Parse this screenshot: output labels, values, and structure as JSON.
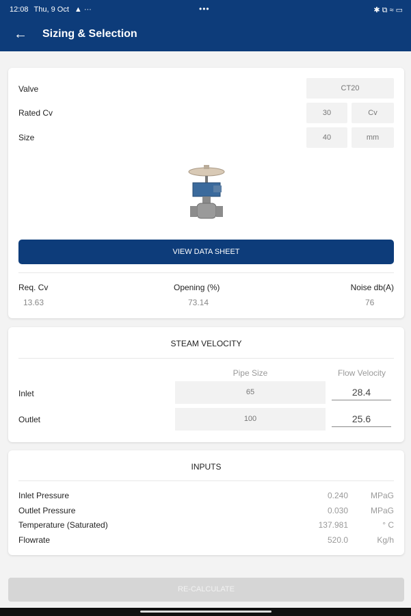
{
  "status": {
    "time": "12:08",
    "date": "Thu, 9 Oct",
    "extra": "▲ ···",
    "center": "•••",
    "right_icons": "✱ ⧉ ≈ ▭"
  },
  "appbar": {
    "back_icon": "arrow-left",
    "title": "Sizing & Selection"
  },
  "valve_card": {
    "valve_label": "Valve",
    "valve_value": "CT20",
    "rated_cv_label": "Rated Cv",
    "rated_cv_value": "30",
    "rated_cv_unit": "Cv",
    "size_label": "Size",
    "size_value": "40",
    "size_unit": "mm",
    "datasheet_button": "VIEW DATA SHEET",
    "req_cv_label": "Req. Cv",
    "req_cv_value": "13.63",
    "opening_label": "Opening (%)",
    "opening_value": "73.14",
    "noise_label": "Noise db(A)",
    "noise_value": "76"
  },
  "steam": {
    "title": "STEAM VELOCITY",
    "pipe_size_header": "Pipe Size",
    "flow_velocity_header": "Flow Velocity",
    "inlet_label": "Inlet",
    "inlet_pipe": "65",
    "inlet_velocity": "28.4",
    "outlet_label": "Outlet",
    "outlet_pipe": "100",
    "outlet_velocity": "25.6"
  },
  "inputs": {
    "title": "INPUTS",
    "rows": [
      {
        "label": "Inlet Pressure",
        "value": "0.240",
        "unit": "MPaG"
      },
      {
        "label": "Outlet Pressure",
        "value": "0.030",
        "unit": "MPaG"
      },
      {
        "label": "Temperature (Saturated)",
        "value": "137.981",
        "unit": "° C"
      },
      {
        "label": "Flowrate",
        "value": "520.0",
        "unit": "Kg/h"
      }
    ]
  },
  "recalc_button": "RE-CALCULATE",
  "colors": {
    "primary": "#0d3c7a",
    "disabled": "#d6d6d6"
  }
}
